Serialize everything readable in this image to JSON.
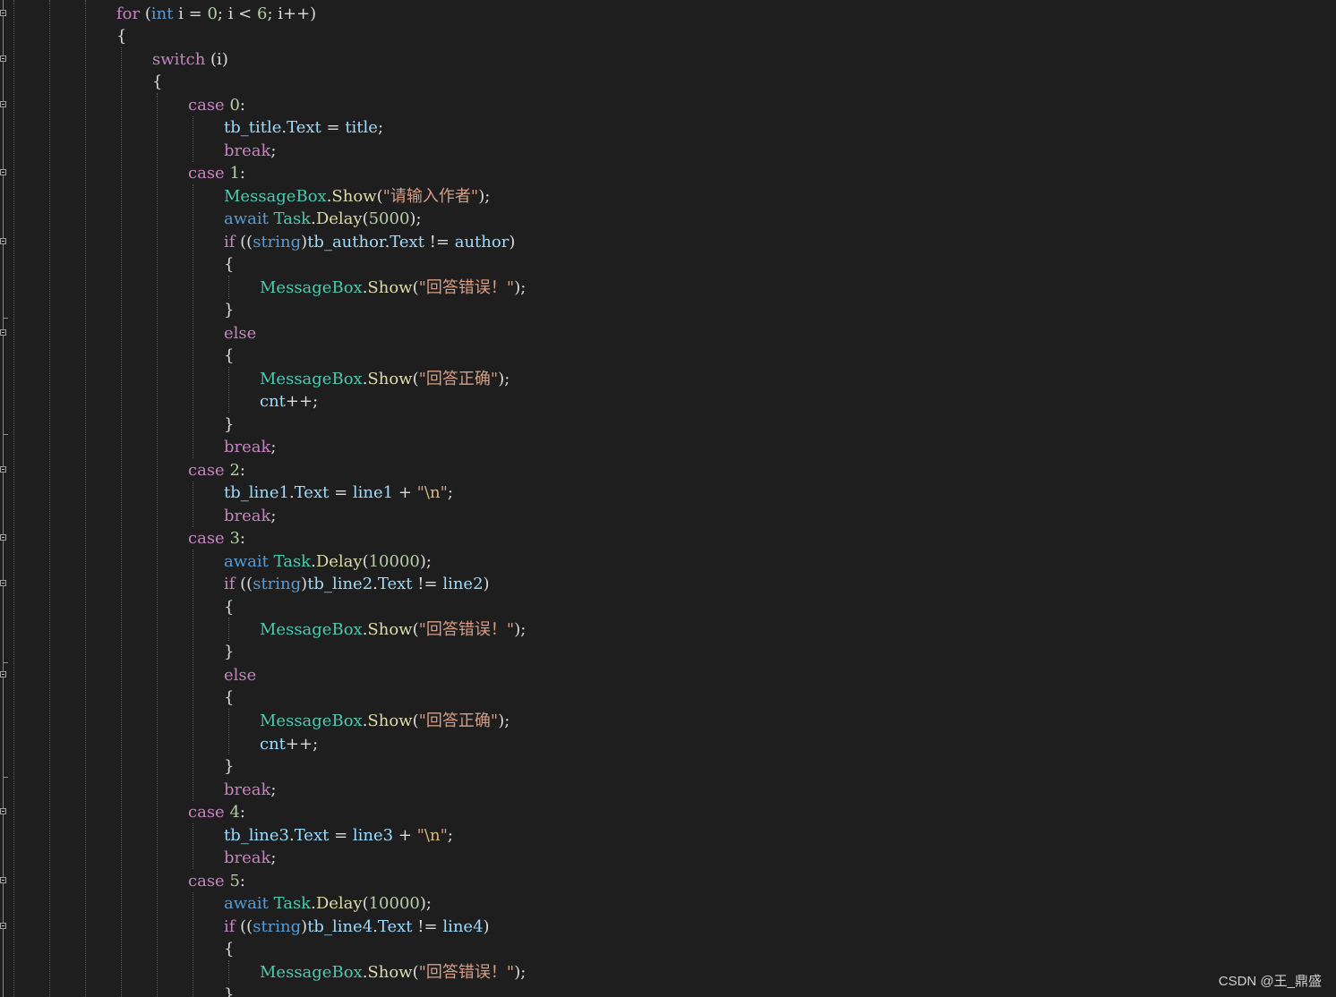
{
  "editor": {
    "watermark": "CSDN @王_鼎盛"
  },
  "code_lines": [
    [
      "for",
      " (",
      "int",
      " i = ",
      "0",
      "; i < ",
      "6",
      "; i++)"
    ],
    [
      "{"
    ],
    [
      "switch",
      " (i)"
    ],
    [
      "{"
    ],
    [
      "case",
      " ",
      "0",
      ":"
    ],
    [
      "tb_title",
      ".",
      "Text",
      " = ",
      "title",
      ";"
    ],
    [
      "break",
      ";"
    ],
    [
      "case",
      " ",
      "1",
      ":"
    ],
    [
      "MessageBox",
      ".",
      "Show",
      "(",
      "\"请输入作者\"",
      ");"
    ],
    [
      "await",
      " ",
      "Task",
      ".",
      "Delay",
      "(",
      "5000",
      ");"
    ],
    [
      "if",
      " ((",
      "string",
      ")",
      "tb_author",
      ".",
      "Text",
      " != ",
      "author",
      ")"
    ],
    [
      "{"
    ],
    [
      "MessageBox",
      ".",
      "Show",
      "(",
      "\"回答错误！\"",
      ");"
    ],
    [
      "}"
    ],
    [
      "else"
    ],
    [
      "{"
    ],
    [
      "MessageBox",
      ".",
      "Show",
      "(",
      "\"回答正确\"",
      ");"
    ],
    [
      "cnt",
      "++;"
    ],
    [
      "}"
    ],
    [
      "break",
      ";"
    ],
    [
      "case",
      " ",
      "2",
      ":"
    ],
    [
      "tb_line1",
      ".",
      "Text",
      " = ",
      "line1",
      " + ",
      "\"",
      "\\n",
      "\"",
      ";"
    ],
    [
      "break",
      ";"
    ],
    [
      "case",
      " ",
      "3",
      ":"
    ],
    [
      "await",
      " ",
      "Task",
      ".",
      "Delay",
      "(",
      "10000",
      ");"
    ],
    [
      "if",
      " ((",
      "string",
      ")",
      "tb_line2",
      ".",
      "Text",
      " != ",
      "line2",
      ")"
    ],
    [
      "{"
    ],
    [
      "MessageBox",
      ".",
      "Show",
      "(",
      "\"回答错误！\"",
      ");"
    ],
    [
      "}"
    ],
    [
      "else"
    ],
    [
      "{"
    ],
    [
      "MessageBox",
      ".",
      "Show",
      "(",
      "\"回答正确\"",
      ");"
    ],
    [
      "cnt",
      "++;"
    ],
    [
      "}"
    ],
    [
      "break",
      ";"
    ],
    [
      "case",
      " ",
      "4",
      ":"
    ],
    [
      "tb_line3",
      ".",
      "Text",
      " = ",
      "line3",
      " + ",
      "\"",
      "\\n",
      "\"",
      ";"
    ],
    [
      "break",
      ";"
    ],
    [
      "case",
      " ",
      "5",
      ":"
    ],
    [
      "await",
      " ",
      "Task",
      ".",
      "Delay",
      "(",
      "10000",
      ");"
    ],
    [
      "if",
      " ((",
      "string",
      ")",
      "tb_line4",
      ".",
      "Text",
      " != ",
      "line4",
      ")"
    ],
    [
      "{"
    ],
    [
      "MessageBox",
      ".",
      "Show",
      "(",
      "\"回答错误！\"",
      ");"
    ],
    [
      "}"
    ]
  ],
  "syntax_colors": {
    "keyword": "#c586c0",
    "type_keyword": "#569cd6",
    "class": "#4ec9b0",
    "method": "#dcdcaa",
    "variable": "#9cdcfe",
    "number": "#b5cea8",
    "string": "#d69d85",
    "text": "#dcdcdc",
    "background": "#1e1e1e"
  }
}
